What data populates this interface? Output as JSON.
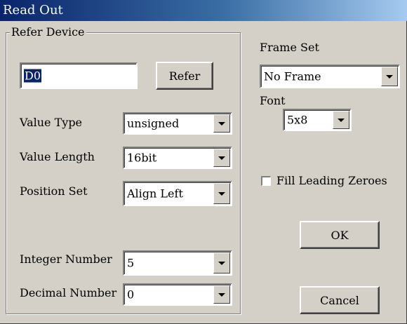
{
  "window": {
    "title": "Read Out"
  },
  "refer_device": {
    "group_label": "Refer Device",
    "device_value": "D0",
    "refer_button": "Refer",
    "value_type": {
      "label": "Value Type",
      "selected": "unsigned"
    },
    "value_length": {
      "label": "Value Length",
      "selected": "16bit"
    },
    "position_set": {
      "label": "Position Set",
      "selected": "Align Left"
    },
    "integer_number": {
      "label": "Integer Number",
      "selected": "5"
    },
    "decimal_number": {
      "label": "Decimal Number",
      "selected": "0"
    }
  },
  "frame_set": {
    "label": "Frame Set",
    "selected": "No Frame"
  },
  "font": {
    "label": "Font",
    "selected": "5x8"
  },
  "fill_leading_zeroes": {
    "label": "Fill Leading Zeroes",
    "checked": false
  },
  "buttons": {
    "ok": "OK",
    "cancel": "Cancel"
  },
  "colors": {
    "face": "#d4d0c8",
    "title_start": "#0a246a",
    "title_end": "#a6caf0",
    "selection": "#0a246a"
  },
  "icons": {
    "dropdown": "chevron-down-icon"
  }
}
